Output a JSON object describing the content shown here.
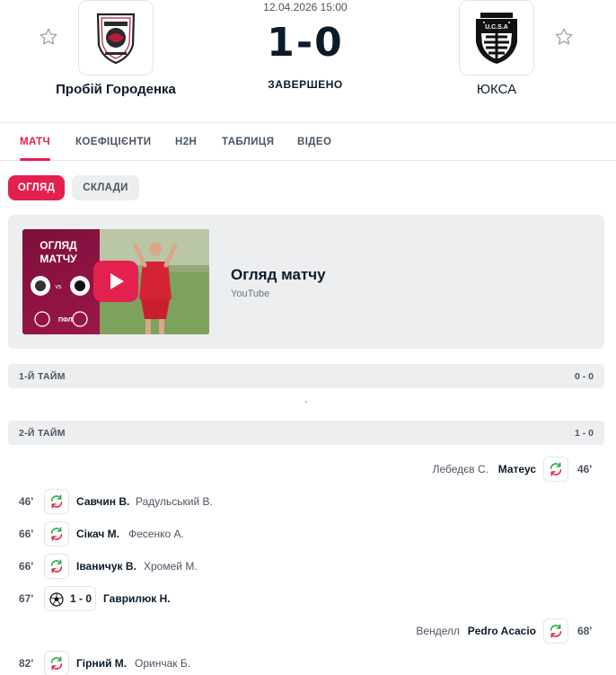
{
  "header": {
    "date": "12.04.2026 15:00",
    "score": "1-0",
    "status": "ЗАВЕРШЕНО",
    "home_team": "Пробій Городенка",
    "away_team": "ЮКСА",
    "away_logo_text": "U.C.S.A"
  },
  "tabs": [
    "МАТЧ",
    "КОЕФІЦІЄНТИ",
    "H2H",
    "ТАБЛИЦЯ",
    "ВІДЕО"
  ],
  "subtabs": {
    "active": "ОГЛЯД",
    "inactive": "СКЛАДИ"
  },
  "video": {
    "title": "Огляд матчу",
    "source": "YouTube",
    "thumb_text_line1": "ОГЛЯД",
    "thumb_text_line2": "МАТЧУ",
    "thumb_league": "ПФЛ"
  },
  "periods": [
    {
      "label": "1-Й ТАЙМ",
      "score": "0 - 0"
    },
    {
      "label": "2-Й ТАЙМ",
      "score": "1 - 0"
    }
  ],
  "events": {
    "e1": {
      "minute": "46'",
      "player_in": "Матеус",
      "player_out": "Лебедєв С."
    },
    "e2": {
      "minute": "46'",
      "player_in": "Савчин В.",
      "player_out": "Радульський В."
    },
    "e3": {
      "minute": "66'",
      "player_in": "Сікач М.",
      "player_out": "Фесенко А."
    },
    "e4": {
      "minute": "66'",
      "player_in": "Іваничук В.",
      "player_out": "Хромей М."
    },
    "e5": {
      "minute": "67'",
      "score": "1 - 0",
      "scorer": "Гаврилюк Н."
    },
    "e6": {
      "minute": "68'",
      "player_in": "Pedro Acacio",
      "player_out": "Венделл"
    },
    "e7": {
      "minute": "82'",
      "player_in": "Гірний М.",
      "player_out": "Оринчак Б."
    }
  },
  "colors": {
    "accent": "#e4204f",
    "bar_bg": "#eceef0",
    "sub_green": "#2eaa45",
    "sub_red": "#e4204f"
  },
  "icons": {
    "favorite": "star-outline-icon",
    "substitution": "substitution-icon",
    "goal": "soccer-ball-icon",
    "play": "play-icon"
  }
}
